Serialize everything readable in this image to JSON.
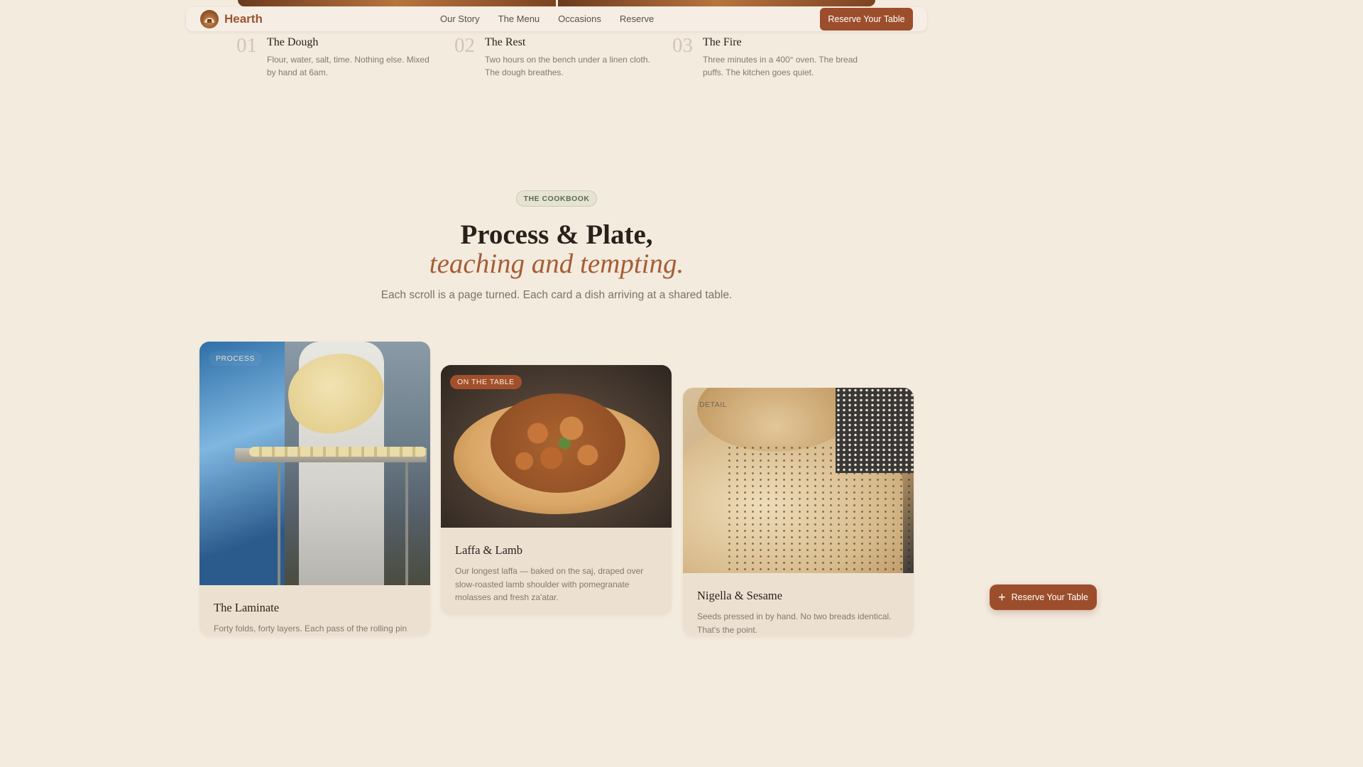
{
  "brand": {
    "name": "Hearth",
    "logo_icon": "hearth-oven-logo"
  },
  "nav": {
    "links": [
      "Our Story",
      "The Menu",
      "Occasions",
      "Reserve"
    ],
    "cta_label": "Reserve Your Table"
  },
  "steps": [
    {
      "number": "01",
      "title": "The Dough",
      "description": "Flour, water, salt, time. Nothing else. Mixed by hand at 6am."
    },
    {
      "number": "02",
      "title": "The Rest",
      "description": "Two hours on the bench under a linen cloth. The dough breathes."
    },
    {
      "number": "03",
      "title": "The Fire",
      "description": "Three minutes in a 400° oven. The bread puffs. The kitchen goes quiet."
    }
  ],
  "section": {
    "badge": "THE COOKBOOK",
    "headline": "Process & Plate,",
    "headline_italic": "teaching and tempting.",
    "subhead": "Each scroll is a page turned. Each card a dish arriving at a shared table."
  },
  "cards": [
    {
      "tag": "PROCESS",
      "title": "The Laminate",
      "description": "Forty folds, forty layers. Each pass of the rolling pin"
    },
    {
      "tag": "ON THE TABLE",
      "title": "Laffa & Lamb",
      "description": "Our longest laffa — baked on the saj, draped over slow-roasted lamb shoulder with pomegranate molasses and fresh za'atar."
    },
    {
      "tag": "DETAIL",
      "title": "Nigella & Sesame",
      "description": "Seeds pressed in by hand. No two breads identical. That's the point."
    }
  ],
  "floating_cta": {
    "label": "Reserve Your Table",
    "icon": "plus-icon"
  },
  "colors": {
    "accent": "#9c4e2c",
    "background": "#f4ebdf",
    "italic_accent": "#a65d35",
    "badge_green": "#5f6b4f"
  }
}
